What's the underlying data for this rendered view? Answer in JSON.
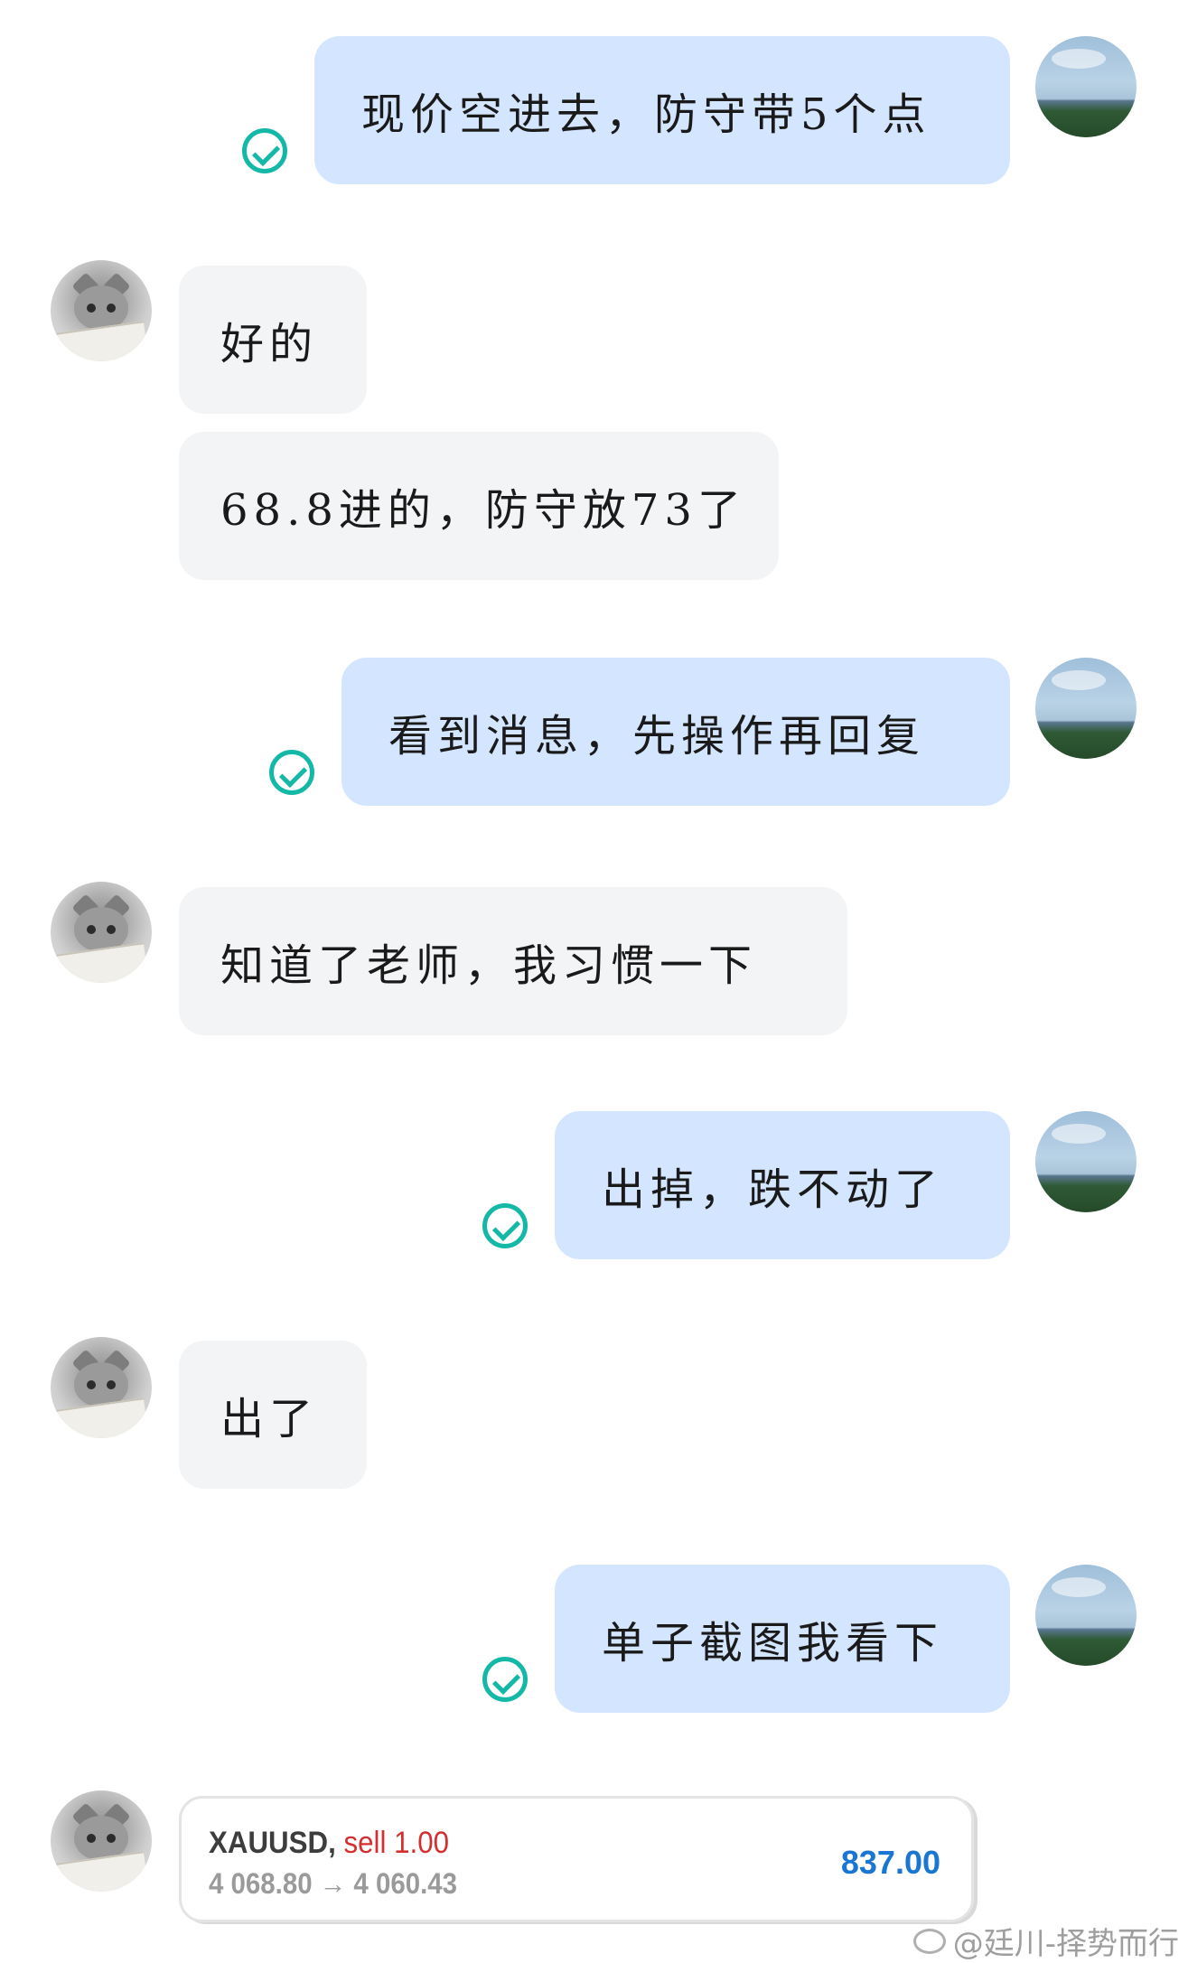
{
  "messages": [
    {
      "from": "me",
      "text": "现价空进去，防守带5个点",
      "status": "delivered"
    },
    {
      "from": "them",
      "text": "好的"
    },
    {
      "from": "them",
      "text": "68.8进的，防守放73了"
    },
    {
      "from": "me",
      "text": "看到消息，先操作再回复",
      "status": "delivered"
    },
    {
      "from": "them",
      "text": "知道了老师，我习惯一下"
    },
    {
      "from": "me",
      "text": "出掉，跌不动了",
      "status": "delivered"
    },
    {
      "from": "them",
      "text": "出了"
    },
    {
      "from": "me",
      "text": "单子截图我看下",
      "status": "delivered"
    }
  ],
  "trade_card": {
    "symbol": "XAUUSD,",
    "side": "sell 1.00",
    "prices": "4 068.80 → 4 060.43",
    "profit": "837.00"
  },
  "watermark": "@廷川-择势而行",
  "colors": {
    "my_bubble": "#d4e5ff",
    "their_bubble": "#f3f4f6",
    "delivered_check": "#14b8a6",
    "sell_red": "#d32f2f",
    "profit_blue": "#1976d2"
  },
  "icons": {
    "my_avatar": "landscape-avatar",
    "their_avatar": "cat-avatar",
    "delivered": "check-circle-icon"
  }
}
